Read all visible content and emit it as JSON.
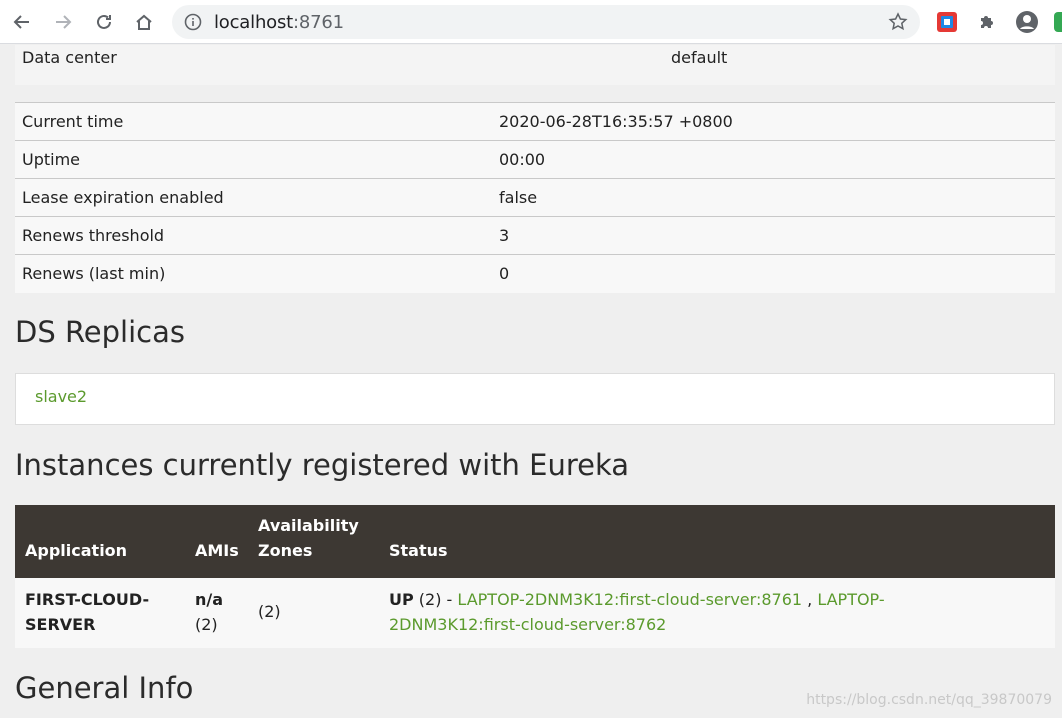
{
  "browser": {
    "url_host": "localhost",
    "url_port": ":8761"
  },
  "data_center": {
    "label": "Data center",
    "value": "default"
  },
  "info_rows": [
    {
      "label": "Current time",
      "value": "2020-06-28T16:35:57 +0800"
    },
    {
      "label": "Uptime",
      "value": "00:00"
    },
    {
      "label": "Lease expiration enabled",
      "value": "false"
    },
    {
      "label": "Renews threshold",
      "value": "3"
    },
    {
      "label": "Renews (last min)",
      "value": "0"
    }
  ],
  "replicas": {
    "heading": "DS Replicas",
    "items": [
      "slave2"
    ]
  },
  "instances": {
    "heading": "Instances currently registered with Eureka",
    "columns": {
      "application": "Application",
      "amis": "AMIs",
      "availability_zones_line1": "Availability",
      "availability_zones_line2": "Zones",
      "status": "Status"
    },
    "rows": [
      {
        "application_line1": "FIRST-CLOUD-",
        "application_line2": "SERVER",
        "amis_line1": "n/a",
        "amis_line2": "(2)",
        "zones": "(2)",
        "status_prefix": "UP",
        "status_count": " (2) - ",
        "link1": "LAPTOP-2DNM3K12:first-cloud-server:8761",
        "separator": " , ",
        "link2_line1": "LAPTOP-",
        "link2_line2": "2DNM3K12:first-cloud-server:8762"
      }
    ]
  },
  "general_info": {
    "heading": "General Info"
  },
  "watermark": "https://blog.csdn.net/qq_39870079",
  "colors": {
    "link": "#5b9a2d",
    "header_bg": "#3d3833",
    "page_bg": "#efefef"
  }
}
